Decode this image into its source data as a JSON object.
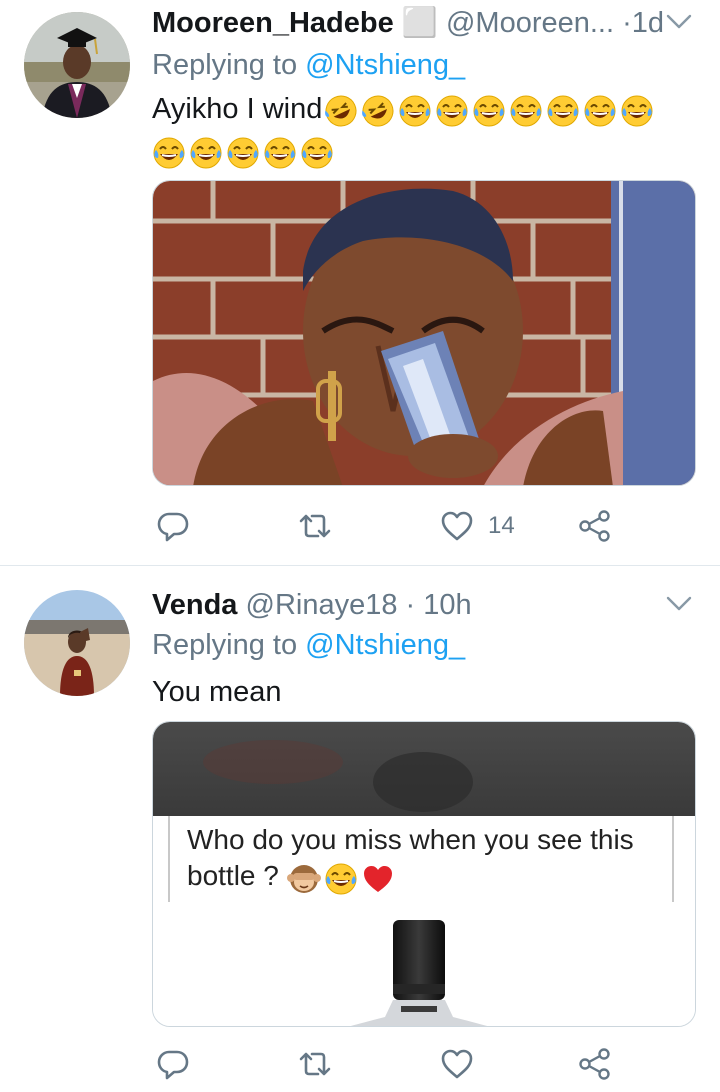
{
  "tweets": [
    {
      "name": "Mooreen_Hadebe ⬜",
      "handle": "@Mooreen...",
      "dot": "·",
      "time": "1d",
      "reply_prefix": "Replying to ",
      "reply_mention": "@Ntshieng_",
      "text": "Ayikho I wind",
      "emojis": [
        "rofl",
        "rofl",
        "joy",
        "joy",
        "joy",
        "joy",
        "joy",
        "joy",
        "joy",
        "joy",
        "joy",
        "joy",
        "joy",
        "joy"
      ],
      "actions": {
        "like_count": "14"
      }
    },
    {
      "name": "Venda",
      "handle": "@Rinaye18",
      "dot": "·",
      "time": "10h",
      "reply_prefix": "Replying to ",
      "reply_mention": "@Ntshieng_",
      "text": "You mean",
      "media_text": "Who do you miss when you see this",
      "media_text_2": "bottle ?",
      "media_emojis": [
        "see-no-evil-monkey",
        "joy",
        "red-heart"
      ],
      "actions": {
        "like_count": ""
      }
    }
  ],
  "colors": {
    "accent": "#1da1f2",
    "secondary_text": "#657786",
    "divider": "#e1e8ed"
  },
  "icons": [
    "chevron-down-icon",
    "reply-icon",
    "retweet-icon",
    "like-icon",
    "share-icon"
  ]
}
